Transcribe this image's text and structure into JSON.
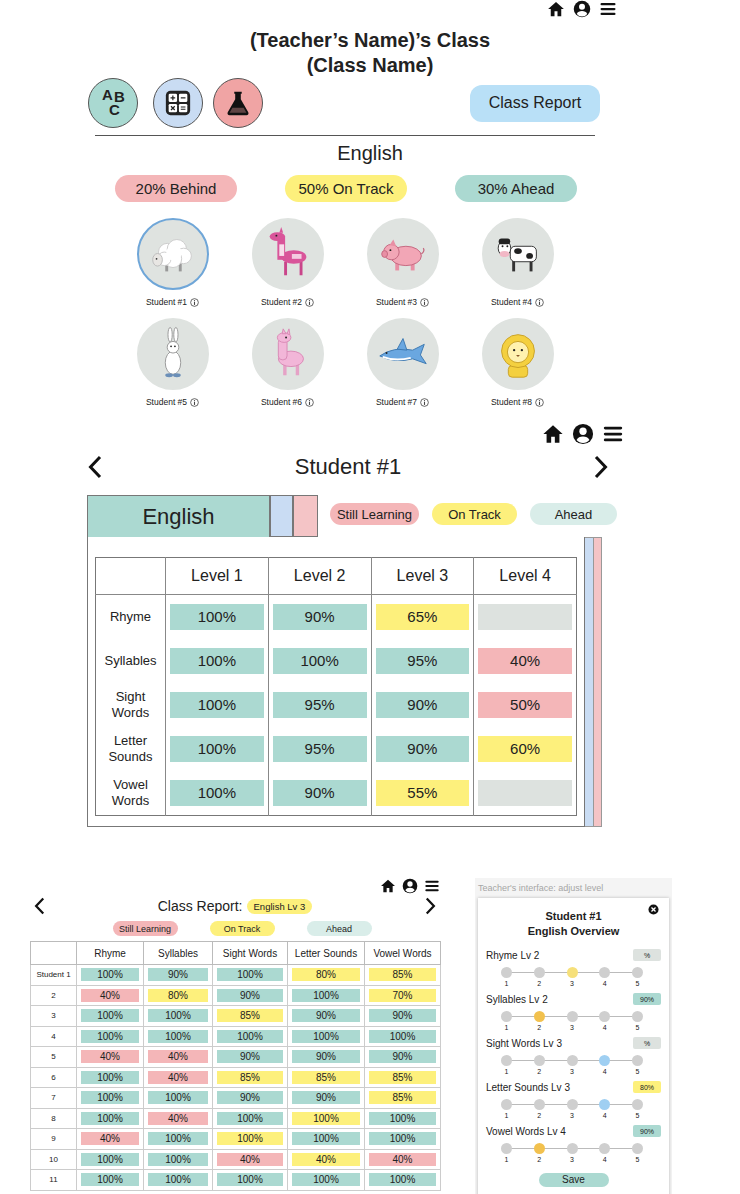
{
  "class_view": {
    "title": "(Teacher’s Name)’s Class",
    "subtitle": "(Class Name)",
    "subjects": [
      {
        "glyphs": [
          "A",
          "B",
          "C"
        ],
        "color": "#a9d9d1"
      },
      {
        "color": "#c9dcf3"
      },
      {
        "color": "#f0a4a4"
      }
    ],
    "report_button": "Class Report",
    "subject": "English",
    "summary": [
      {
        "label": "20% Behind",
        "color": "#f4b6b8"
      },
      {
        "label": "50% On Track",
        "color": "#fdf07c"
      },
      {
        "label": "30% Ahead",
        "color": "#abd9d1"
      }
    ],
    "students": [
      {
        "label": "Student #1",
        "selected": true
      },
      {
        "label": "Student #2",
        "selected": false
      },
      {
        "label": "Student #3",
        "selected": false
      },
      {
        "label": "Student #4",
        "selected": false
      },
      {
        "label": "Student #5",
        "selected": false
      },
      {
        "label": "Student #6",
        "selected": false
      },
      {
        "label": "Student #7",
        "selected": false
      },
      {
        "label": "Student #8",
        "selected": false
      }
    ]
  },
  "student_view": {
    "title": "Student #1",
    "tabs": [
      {
        "label": "English",
        "selected": true,
        "color": "#abd9d1"
      },
      {
        "selected": false,
        "color": "#c9dcf3"
      },
      {
        "selected": false,
        "color": "#f4c4c6"
      }
    ],
    "legend": [
      {
        "label": "Still Learning",
        "color": "#f4b6b8"
      },
      {
        "label": "On Track",
        "color": "#fdf07c"
      },
      {
        "label": "Ahead",
        "color": "#d9ede9"
      }
    ],
    "table": {
      "columns": [
        "Level 1",
        "Level 2",
        "Level 3",
        "Level 4"
      ],
      "rows": [
        {
          "label": "Rhyme",
          "cells": [
            {
              "text": "100%",
              "status": "ahead"
            },
            {
              "text": "90%",
              "status": "ahead"
            },
            {
              "text": "65%",
              "status": "on-track"
            },
            {
              "status": "empty"
            }
          ]
        },
        {
          "label": "Syllables",
          "cells": [
            {
              "text": "100%",
              "status": "ahead"
            },
            {
              "text": "100%",
              "status": "ahead"
            },
            {
              "text": "95%",
              "status": "ahead"
            },
            {
              "text": "40%",
              "status": "still-learning"
            }
          ]
        },
        {
          "label": "Sight Words",
          "cells": [
            {
              "text": "100%",
              "status": "ahead"
            },
            {
              "text": "95%",
              "status": "ahead"
            },
            {
              "text": "90%",
              "status": "ahead"
            },
            {
              "text": "50%",
              "status": "still-learning"
            }
          ]
        },
        {
          "label": "Letter Sounds",
          "cells": [
            {
              "text": "100%",
              "status": "ahead"
            },
            {
              "text": "95%",
              "status": "ahead"
            },
            {
              "text": "90%",
              "status": "ahead"
            },
            {
              "text": "60%",
              "status": "on-track"
            }
          ]
        },
        {
          "label": "Vowel Words",
          "cells": [
            {
              "text": "100%",
              "status": "ahead"
            },
            {
              "text": "90%",
              "status": "ahead"
            },
            {
              "text": "55%",
              "status": "on-track"
            },
            {
              "status": "empty"
            }
          ]
        }
      ]
    }
  },
  "class_report": {
    "title": "Class Report:",
    "level_tag": "English Lv 3",
    "legend": [
      {
        "label": "Still Learning",
        "color": "#f4b6b8"
      },
      {
        "label": "On Track",
        "color": "#fdf07c"
      },
      {
        "label": "Ahead",
        "color": "#d9ede9"
      }
    ],
    "columns": [
      "Rhyme",
      "Syllables",
      "Sight Words",
      "Letter Sounds",
      "Vowel Words"
    ],
    "rows": [
      {
        "label": "Student 1",
        "cells": [
          {
            "text": "100%",
            "status": "ahead"
          },
          {
            "text": "90%",
            "status": "ahead"
          },
          {
            "text": "100%",
            "status": "ahead"
          },
          {
            "text": "80%",
            "status": "on-track"
          },
          {
            "text": "85%",
            "status": "on-track"
          }
        ]
      },
      {
        "label": "2",
        "cells": [
          {
            "text": "40%",
            "status": "still-learning"
          },
          {
            "text": "80%",
            "status": "on-track"
          },
          {
            "text": "90%",
            "status": "ahead"
          },
          {
            "text": "100%",
            "status": "ahead"
          },
          {
            "text": "70%",
            "status": "on-track"
          }
        ]
      },
      {
        "label": "3",
        "cells": [
          {
            "text": "100%",
            "status": "ahead"
          },
          {
            "text": "100%",
            "status": "ahead"
          },
          {
            "text": "85%",
            "status": "on-track"
          },
          {
            "text": "90%",
            "status": "ahead"
          },
          {
            "text": "90%",
            "status": "ahead"
          }
        ]
      },
      {
        "label": "4",
        "cells": [
          {
            "text": "100%",
            "status": "ahead"
          },
          {
            "text": "100%",
            "status": "ahead"
          },
          {
            "text": "100%",
            "status": "ahead"
          },
          {
            "text": "100%",
            "status": "ahead"
          },
          {
            "text": "100%",
            "status": "ahead"
          }
        ]
      },
      {
        "label": "5",
        "cells": [
          {
            "text": "40%",
            "status": "still-learning"
          },
          {
            "text": "40%",
            "status": "still-learning"
          },
          {
            "text": "90%",
            "status": "ahead"
          },
          {
            "text": "90%",
            "status": "ahead"
          },
          {
            "text": "90%",
            "status": "ahead"
          }
        ]
      },
      {
        "label": "6",
        "cells": [
          {
            "text": "100%",
            "status": "ahead"
          },
          {
            "text": "40%",
            "status": "still-learning"
          },
          {
            "text": "85%",
            "status": "on-track"
          },
          {
            "text": "85%",
            "status": "on-track"
          },
          {
            "text": "85%",
            "status": "on-track"
          }
        ]
      },
      {
        "label": "7",
        "cells": [
          {
            "text": "100%",
            "status": "ahead"
          },
          {
            "text": "100%",
            "status": "ahead"
          },
          {
            "text": "90%",
            "status": "ahead"
          },
          {
            "text": "90%",
            "status": "ahead"
          },
          {
            "text": "85%",
            "status": "on-track"
          }
        ]
      },
      {
        "label": "8",
        "cells": [
          {
            "text": "100%",
            "status": "ahead"
          },
          {
            "text": "40%",
            "status": "still-learning"
          },
          {
            "text": "100%",
            "status": "ahead"
          },
          {
            "text": "100%",
            "status": "on-track"
          },
          {
            "text": "100%",
            "status": "ahead"
          }
        ]
      },
      {
        "label": "9",
        "cells": [
          {
            "text": "40%",
            "status": "still-learning"
          },
          {
            "text": "100%",
            "status": "ahead"
          },
          {
            "text": "100%",
            "status": "on-track"
          },
          {
            "text": "100%",
            "status": "ahead"
          },
          {
            "text": "100%",
            "status": "ahead"
          }
        ]
      },
      {
        "label": "10",
        "cells": [
          {
            "text": "100%",
            "status": "ahead"
          },
          {
            "text": "100%",
            "status": "ahead"
          },
          {
            "text": "40%",
            "status": "still-learning"
          },
          {
            "text": "40%",
            "status": "on-track"
          },
          {
            "text": "40%",
            "status": "still-learning"
          }
        ]
      },
      {
        "label": "11",
        "cells": [
          {
            "text": "100%",
            "status": "ahead"
          },
          {
            "text": "100%",
            "status": "ahead"
          },
          {
            "text": "100%",
            "status": "ahead"
          },
          {
            "text": "100%",
            "status": "ahead"
          },
          {
            "text": "100%",
            "status": "ahead"
          }
        ]
      }
    ]
  },
  "adjust_panel": {
    "caption": "Teacher's interface: adjust level",
    "title": "Student #1",
    "subtitle": "English Overview",
    "rows": [
      {
        "label": "Rhyme Lv 2",
        "badge": {
          "text": "%",
          "status": "empty"
        },
        "color": "#f6e07a",
        "dots": [
          {
            "label": "1",
            "selected": false
          },
          {
            "label": "2",
            "selected": false
          },
          {
            "label": "3",
            "selected": true
          },
          {
            "label": "4",
            "selected": false
          },
          {
            "label": "5",
            "selected": false
          }
        ]
      },
      {
        "label": "Syllables Lv 2",
        "badge": {
          "text": "90%",
          "status": "ahead"
        },
        "color": "#f2c14e",
        "dots": [
          {
            "label": "1",
            "selected": false
          },
          {
            "label": "2",
            "selected": true
          },
          {
            "label": "3",
            "selected": false
          },
          {
            "label": "4",
            "selected": false
          },
          {
            "label": "5",
            "selected": false
          }
        ]
      },
      {
        "label": "Sight Words Lv 3",
        "badge": {
          "text": "%",
          "status": "empty"
        },
        "color": "#9fcff2",
        "dots": [
          {
            "label": "1",
            "selected": false
          },
          {
            "label": "2",
            "selected": false
          },
          {
            "label": "3",
            "selected": false
          },
          {
            "label": "4",
            "selected": true
          },
          {
            "label": "5",
            "selected": false
          }
        ]
      },
      {
        "label": "Letter Sounds Lv 3",
        "badge": {
          "text": "80%",
          "status": "on-track"
        },
        "color": "#9fcff2",
        "dots": [
          {
            "label": "1",
            "selected": false
          },
          {
            "label": "2",
            "selected": false
          },
          {
            "label": "3",
            "selected": false
          },
          {
            "label": "4",
            "selected": true
          },
          {
            "label": "5",
            "selected": false
          }
        ]
      },
      {
        "label": "Vowel Words Lv 4",
        "badge": {
          "text": "90%",
          "status": "ahead"
        },
        "color": "#f2c14e",
        "dots": [
          {
            "label": "1",
            "selected": false
          },
          {
            "label": "2",
            "selected": true
          },
          {
            "label": "3",
            "selected": false
          },
          {
            "label": "4",
            "selected": false
          },
          {
            "label": "5",
            "selected": false
          }
        ]
      }
    ],
    "save": "Save"
  }
}
